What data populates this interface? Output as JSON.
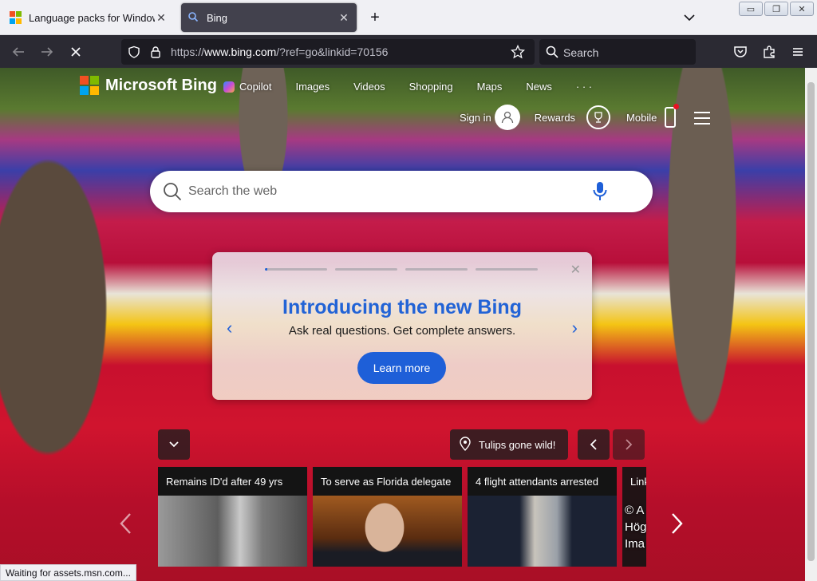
{
  "tabs": [
    {
      "title": "Language packs for Windows -",
      "active": false
    },
    {
      "title": "Bing",
      "active": true
    }
  ],
  "toolbar": {
    "url_prefix": "https://",
    "url_host": "www.bing.com",
    "url_rest": "/?ref=go&linkid=70156",
    "search_placeholder": "Search"
  },
  "bing": {
    "brand": "Microsoft Bing",
    "scopes": [
      "Copilot",
      "Images",
      "Videos",
      "Shopping",
      "Maps",
      "News",
      "· · ·"
    ],
    "sign_in": "Sign in",
    "rewards": "Rewards",
    "mobile": "Mobile",
    "search_placeholder": "Search the web",
    "carousel": {
      "title": "Introducing the new Bing",
      "subtitle": "Ask real questions. Get complete answers.",
      "cta": "Learn more"
    },
    "image_location": "Tulips gone wild!",
    "news": [
      {
        "headline": "Remains ID'd after 49 yrs"
      },
      {
        "headline": "To serve as Florida delegate"
      },
      {
        "headline": "4 flight attendants arrested"
      },
      {
        "headline": "Link"
      }
    ],
    "copyright_lines": [
      "© A",
      "Hög",
      "Ima"
    ]
  },
  "status_text": "Waiting for assets.msn.com...",
  "colors": {
    "accent": "#1e5fd8",
    "browser_dark": "#2b2a33",
    "ms_red": "#f25022",
    "ms_green": "#7fba00",
    "ms_blue": "#00a4ef",
    "ms_yellow": "#ffb900"
  }
}
